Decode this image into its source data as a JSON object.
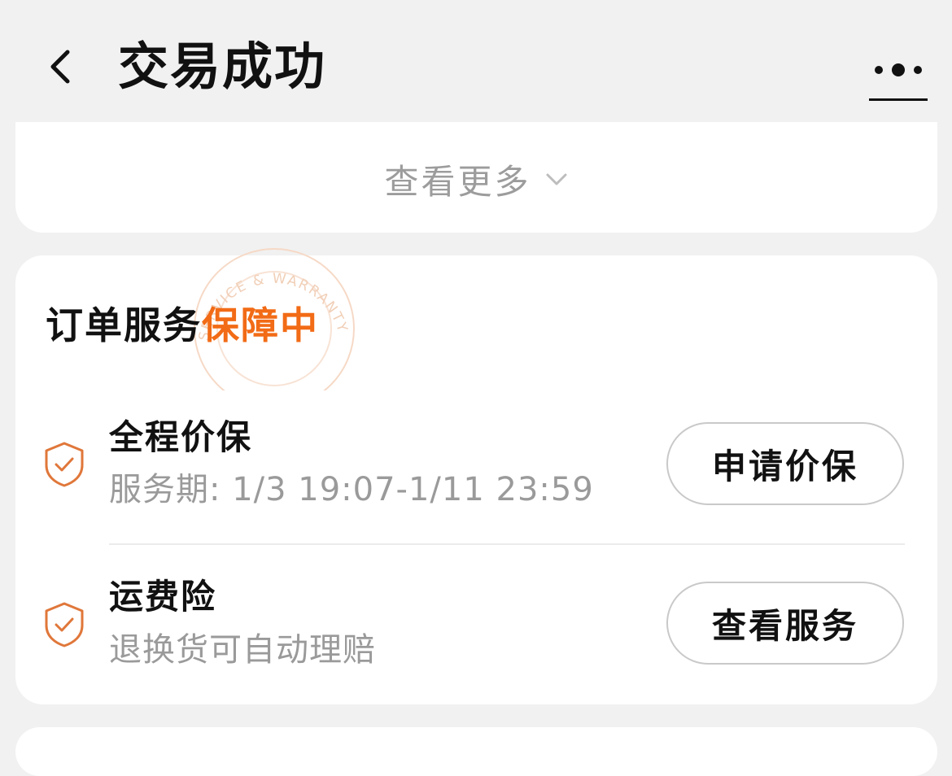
{
  "nav": {
    "title": "交易成功"
  },
  "order_details": {
    "view_more_label": "查看更多"
  },
  "service_section": {
    "title_prefix": "订单服务",
    "title_highlight": "保障中",
    "stamp_text": "SERVICE & WARRANTY",
    "items": [
      {
        "name": "全程价保",
        "description": "服务期: 1/3 19:07-1/11 23:59",
        "button_label": "申请价保"
      },
      {
        "name": "运费险",
        "description": "退换货可自动理赔",
        "button_label": "查看服务"
      }
    ]
  },
  "icons": {
    "back": "chevron-left-icon",
    "more": "more-dots-icon",
    "expand": "chevron-down-icon",
    "service": "shield-check-icon"
  },
  "colors": {
    "background": "#f1f1f1",
    "card": "#ffffff",
    "accent": "#f26b16",
    "shield_icon": "#e0773a",
    "muted_text": "#9a9a9a"
  }
}
